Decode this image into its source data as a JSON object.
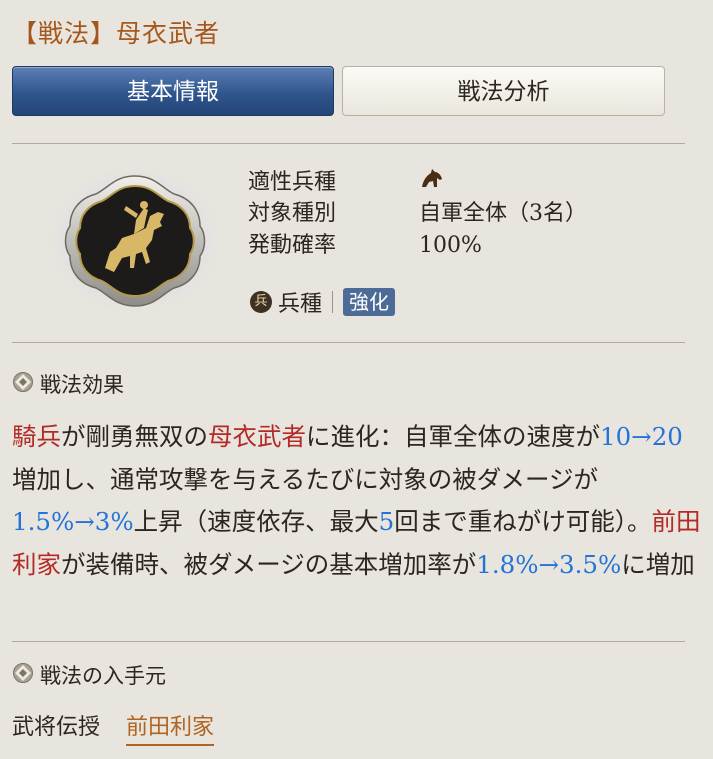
{
  "header": {
    "title": "【戦法】母衣武者"
  },
  "tabs": [
    {
      "label": "基本情報",
      "active": true
    },
    {
      "label": "戦法分析",
      "active": false
    }
  ],
  "info": {
    "unit_type_label": "適性兵種",
    "unit_type_icon": "horse-icon",
    "target_label": "対象種別",
    "target_value": "自軍全体（3名）",
    "rate_label": "発動確率",
    "rate_value": "100%"
  },
  "tags": {
    "troop_badge": "兵",
    "troop_label": "兵種",
    "strength_label": "強化"
  },
  "effect": {
    "heading": "戦法効果",
    "segments": [
      {
        "text": "騎兵",
        "style": "red"
      },
      {
        "text": "が剛勇無双の",
        "style": "normal"
      },
      {
        "text": "母衣武者",
        "style": "red"
      },
      {
        "text": "に進化：自軍全体の速度が",
        "style": "normal"
      },
      {
        "text": "10→20",
        "style": "blue"
      },
      {
        "text": "増加し、通常攻撃を与えるたびに対象の被ダメージが",
        "style": "normal"
      },
      {
        "text": "1.5%→3%",
        "style": "blue"
      },
      {
        "text": "上昇（速度依存、最大",
        "style": "normal"
      },
      {
        "text": "5",
        "style": "blue"
      },
      {
        "text": "回まで重ねがけ可能）。",
        "style": "normal"
      },
      {
        "text": "前田利家",
        "style": "red"
      },
      {
        "text": "が装備時、被ダメージの基本増加率が",
        "style": "normal"
      },
      {
        "text": "1.8%→3.5%",
        "style": "blue"
      },
      {
        "text": "に増加",
        "style": "normal"
      }
    ]
  },
  "source": {
    "heading": "戦法の入手元",
    "label": "武将伝授",
    "link": "前田利家"
  },
  "colors": {
    "background": "#e7e5dd",
    "title": "#a5581d",
    "active_tab": "#2f568e",
    "highlight_red": "#b32a26",
    "highlight_blue": "#2473d8",
    "link": "#b2631f"
  }
}
